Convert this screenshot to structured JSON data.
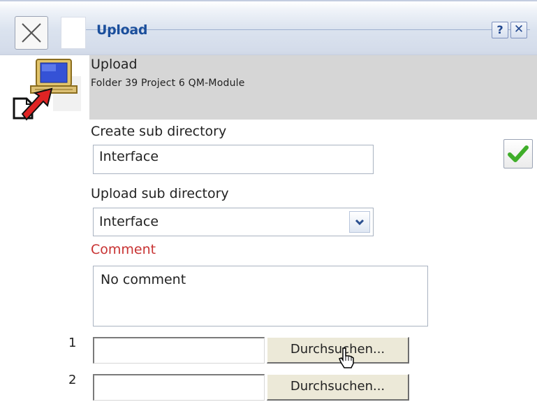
{
  "titlebar": {
    "title": "Upload",
    "help_label": "?",
    "close_label": "✕"
  },
  "header": {
    "title": "Upload",
    "subtitle": "Folder 39 Project 6 QM-Module"
  },
  "form": {
    "create_sub_label": "Create sub directory",
    "create_sub_value": "Interface",
    "upload_sub_label": "Upload sub directory",
    "upload_sub_value": "Interface",
    "comment_label": "Comment",
    "comment_value": "No comment"
  },
  "files": [
    {
      "number": "1",
      "value": "",
      "browse_label": "Durchsuchen..."
    },
    {
      "number": "2",
      "value": "",
      "browse_label": "Durchsuchen..."
    }
  ],
  "colors": {
    "title_blue": "#1b4f9c",
    "comment_red": "#c83232",
    "header_gray": "#d6d6d6",
    "check_green": "#3fae2a"
  },
  "icons": [
    "close-icon",
    "help-icon",
    "upload-icon",
    "checkmark-icon",
    "chevron-down-icon",
    "pointer-cursor-icon"
  ]
}
